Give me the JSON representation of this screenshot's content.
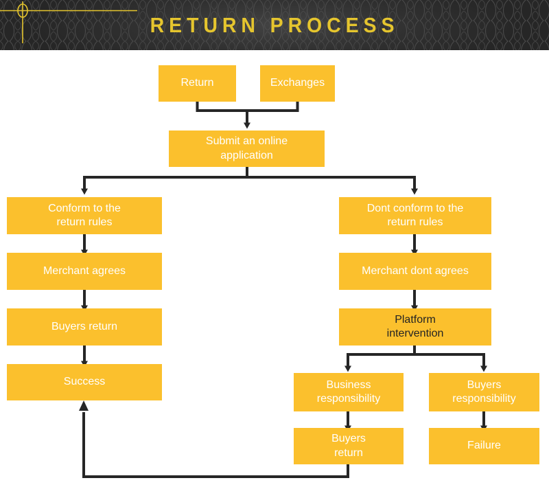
{
  "header": {
    "title": "RETURN PROCESS",
    "background_color": "#2b2b2b",
    "title_color": "#e5c52e",
    "accent_color": "#e5c52e"
  },
  "theme": {
    "node_fill": "#fbc02d",
    "node_text": "#ffffff",
    "node_text_dark": "#232323",
    "connector_color": "#262626",
    "page_background": "#ffffff"
  },
  "chart_data": {
    "type": "diagram",
    "title": "RETURN PROCESS",
    "nodes": [
      {
        "id": "return",
        "label": "Return",
        "text_color": "#ffffff"
      },
      {
        "id": "exchanges",
        "label": "Exchanges",
        "text_color": "#ffffff"
      },
      {
        "id": "submit",
        "label": "Submit an online application",
        "text_color": "#ffffff"
      },
      {
        "id": "conform",
        "label": "Conform to the return rules",
        "text_color": "#ffffff"
      },
      {
        "id": "merchant-agrees",
        "label": "Merchant agrees",
        "text_color": "#ffffff"
      },
      {
        "id": "buyers-return-left",
        "label": "Buyers return",
        "text_color": "#ffffff"
      },
      {
        "id": "success",
        "label": "Success",
        "text_color": "#ffffff"
      },
      {
        "id": "dont-conform",
        "label": "Dont conform to the return rules",
        "text_color": "#ffffff"
      },
      {
        "id": "merchant-dont",
        "label": "Merchant dont agrees",
        "text_color": "#ffffff"
      },
      {
        "id": "platform",
        "label": "Platform intervention",
        "text_color": "#232323"
      },
      {
        "id": "business-resp",
        "label": "Business responsibility",
        "text_color": "#ffffff"
      },
      {
        "id": "buyers-resp",
        "label": "Buyers responsibility",
        "text_color": "#ffffff"
      },
      {
        "id": "buyers-return-right",
        "label": "Buyers return",
        "text_color": "#ffffff"
      },
      {
        "id": "failure",
        "label": "Failure",
        "text_color": "#ffffff"
      }
    ],
    "edges": [
      {
        "from": "return",
        "to": "submit"
      },
      {
        "from": "exchanges",
        "to": "submit"
      },
      {
        "from": "submit",
        "to": "conform"
      },
      {
        "from": "submit",
        "to": "dont-conform"
      },
      {
        "from": "conform",
        "to": "merchant-agrees"
      },
      {
        "from": "merchant-agrees",
        "to": "buyers-return-left"
      },
      {
        "from": "buyers-return-left",
        "to": "success"
      },
      {
        "from": "dont-conform",
        "to": "merchant-dont"
      },
      {
        "from": "merchant-dont",
        "to": "platform"
      },
      {
        "from": "platform",
        "to": "business-resp"
      },
      {
        "from": "platform",
        "to": "buyers-resp"
      },
      {
        "from": "business-resp",
        "to": "buyers-return-right"
      },
      {
        "from": "buyers-resp",
        "to": "failure"
      },
      {
        "from": "buyers-return-right",
        "to": "success"
      }
    ]
  },
  "nodes": {
    "return": {
      "label": "Return"
    },
    "exchanges": {
      "label": "Exchanges"
    },
    "submit": {
      "line1": "Submit an online",
      "line2": "application"
    },
    "conform": {
      "line1": "Conform to the",
      "line2": "return rules"
    },
    "merchant_agrees": {
      "label": "Merchant agrees"
    },
    "buyers_return_left": {
      "label": "Buyers return"
    },
    "success": {
      "label": "Success"
    },
    "dont_conform": {
      "line1": "Dont conform to the",
      "line2": "return rules"
    },
    "merchant_dont": {
      "label": "Merchant dont agrees"
    },
    "platform": {
      "line1": "Platform",
      "line2": "intervention"
    },
    "business_resp": {
      "line1": "Business",
      "line2": "responsibility"
    },
    "buyers_resp": {
      "line1": "Buyers",
      "line2": "responsibility"
    },
    "buyers_return_right": {
      "line1": "Buyers",
      "line2": "return"
    },
    "failure": {
      "label": "Failure"
    }
  }
}
